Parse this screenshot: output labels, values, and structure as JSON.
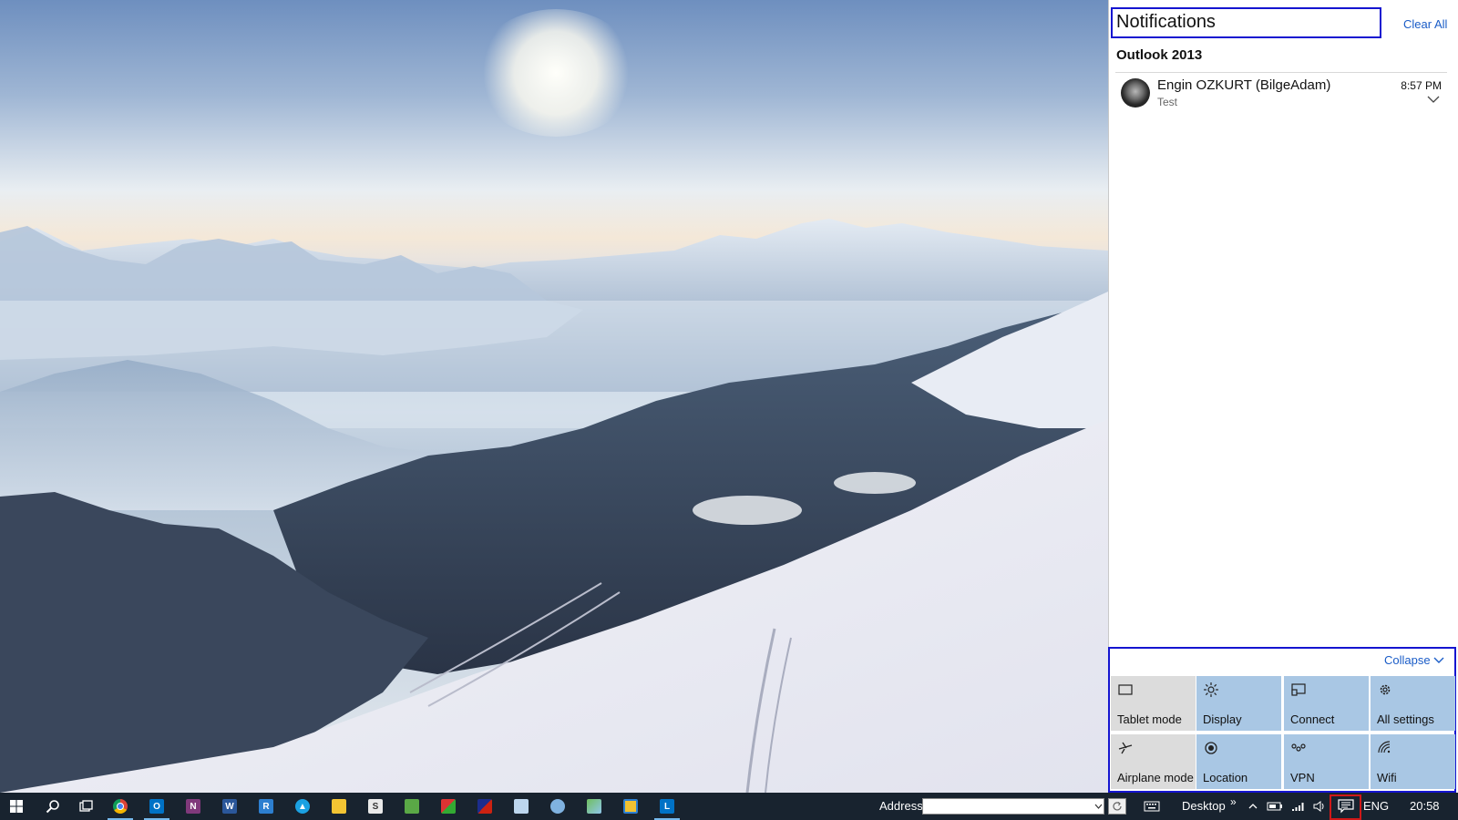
{
  "notifications": {
    "title": "Notifications",
    "clear_all": "Clear All",
    "groups": [
      {
        "app": "Outlook 2013",
        "items": [
          {
            "sender": "Engin OZKURT (BilgeAdam)",
            "body": "Test",
            "time": "8:57 PM"
          }
        ]
      }
    ]
  },
  "quick_actions": {
    "collapse_label": "Collapse",
    "tiles": [
      {
        "label": "Tablet mode",
        "icon": "tablet-mode-icon",
        "state": "off"
      },
      {
        "label": "Display",
        "icon": "brightness-icon",
        "state": "on"
      },
      {
        "label": "Connect",
        "icon": "connect-icon",
        "state": "on"
      },
      {
        "label": "All settings",
        "icon": "gear-icon",
        "state": "on"
      },
      {
        "label": "Airplane mode",
        "icon": "airplane-icon",
        "state": "off"
      },
      {
        "label": "Location",
        "icon": "location-icon",
        "state": "on"
      },
      {
        "label": "VPN",
        "icon": "vpn-icon",
        "state": "on"
      },
      {
        "label": "Wifi",
        "icon": "wifi-icon",
        "state": "on"
      }
    ]
  },
  "taskbar": {
    "pinned_apps": [
      {
        "name": "chrome",
        "icon": "chrome-icon",
        "active": true
      },
      {
        "name": "outlook",
        "icon": "outlook-icon",
        "active": true
      },
      {
        "name": "onenote",
        "icon": "onenote-icon",
        "active": false
      },
      {
        "name": "word",
        "icon": "word-icon",
        "active": false
      },
      {
        "name": "remote-desktop",
        "icon": "remote-desktop-icon",
        "active": false
      },
      {
        "name": "azure",
        "icon": "azure-icon",
        "active": false
      },
      {
        "name": "file-explorer",
        "icon": "folder-icon",
        "active": false
      },
      {
        "name": "store",
        "icon": "store-icon",
        "active": false
      },
      {
        "name": "app-green",
        "icon": "app-icon",
        "active": false
      },
      {
        "name": "app-red-green",
        "icon": "app-icon",
        "active": false
      },
      {
        "name": "app-red-blue",
        "icon": "app-icon",
        "active": false
      },
      {
        "name": "app-chat",
        "icon": "chat-icon",
        "active": false
      },
      {
        "name": "app-gear-globe",
        "icon": "app-icon",
        "active": false
      },
      {
        "name": "app-map",
        "icon": "app-icon",
        "active": false
      },
      {
        "name": "app-yellow",
        "icon": "app-icon",
        "active": false
      },
      {
        "name": "lync",
        "icon": "lync-icon",
        "active": true
      }
    ],
    "address_label": "Address",
    "address_value": "",
    "desktop_label": "Desktop",
    "more_label": "»",
    "language": "ENG",
    "clock": "20:58"
  },
  "colors": {
    "accent_blue": "#1a5cc7",
    "tile_on": "#a9c7e4",
    "tile_off": "#dcdcdc",
    "taskbar": "#18232f",
    "highlight_blue": "#1515d0",
    "highlight_red": "#d01818"
  }
}
